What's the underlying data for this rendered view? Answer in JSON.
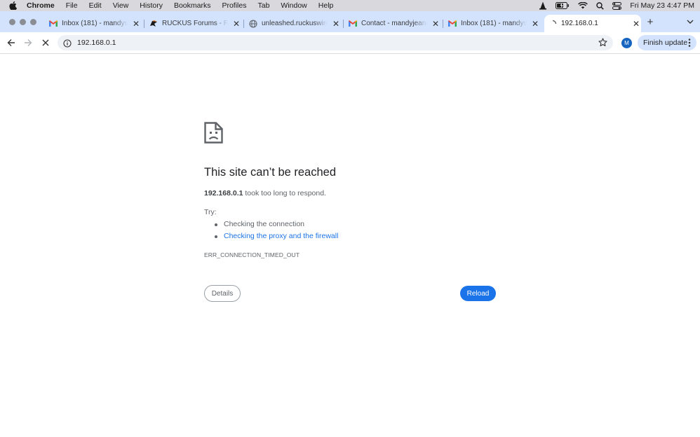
{
  "menubar": {
    "app": "Chrome",
    "items": [
      "File",
      "Edit",
      "View",
      "History",
      "Bookmarks",
      "Profiles",
      "Tab",
      "Window",
      "Help"
    ],
    "clock": "Fri May 23  4:47 PM"
  },
  "tabs": [
    {
      "title": "Inbox (181) - mandysotoc",
      "icon": "gmail-icon"
    },
    {
      "title": "RUCKUS Forums - Re: Ruc",
      "icon": "ruckus-icon"
    },
    {
      "title": "unleashed.ruckuswireless",
      "icon": "globe-icon"
    },
    {
      "title": "Contact - mandyjeanmc",
      "icon": "gmail-icon"
    },
    {
      "title": "Inbox (181) - mandysotoc",
      "icon": "gmail-icon"
    },
    {
      "title": "192.168.0.1",
      "icon": "loading-icon"
    }
  ],
  "toolbar": {
    "url": "192.168.0.1",
    "avatar_initial": "M",
    "update_label": "Finish update"
  },
  "error": {
    "heading": "This site can’t be reached",
    "host": "192.168.0.1",
    "message": "took too long to respond.",
    "try_label": "Try:",
    "suggestion_1": "Checking the connection",
    "suggestion_2": "Checking the proxy and the firewall",
    "code": "ERR_CONNECTION_TIMED_OUT",
    "details_label": "Details",
    "reload_label": "Reload"
  },
  "colors": {
    "tabstrip": "#d3e3fd",
    "link": "#1a73e8",
    "reload_button": "#1a73e8"
  }
}
